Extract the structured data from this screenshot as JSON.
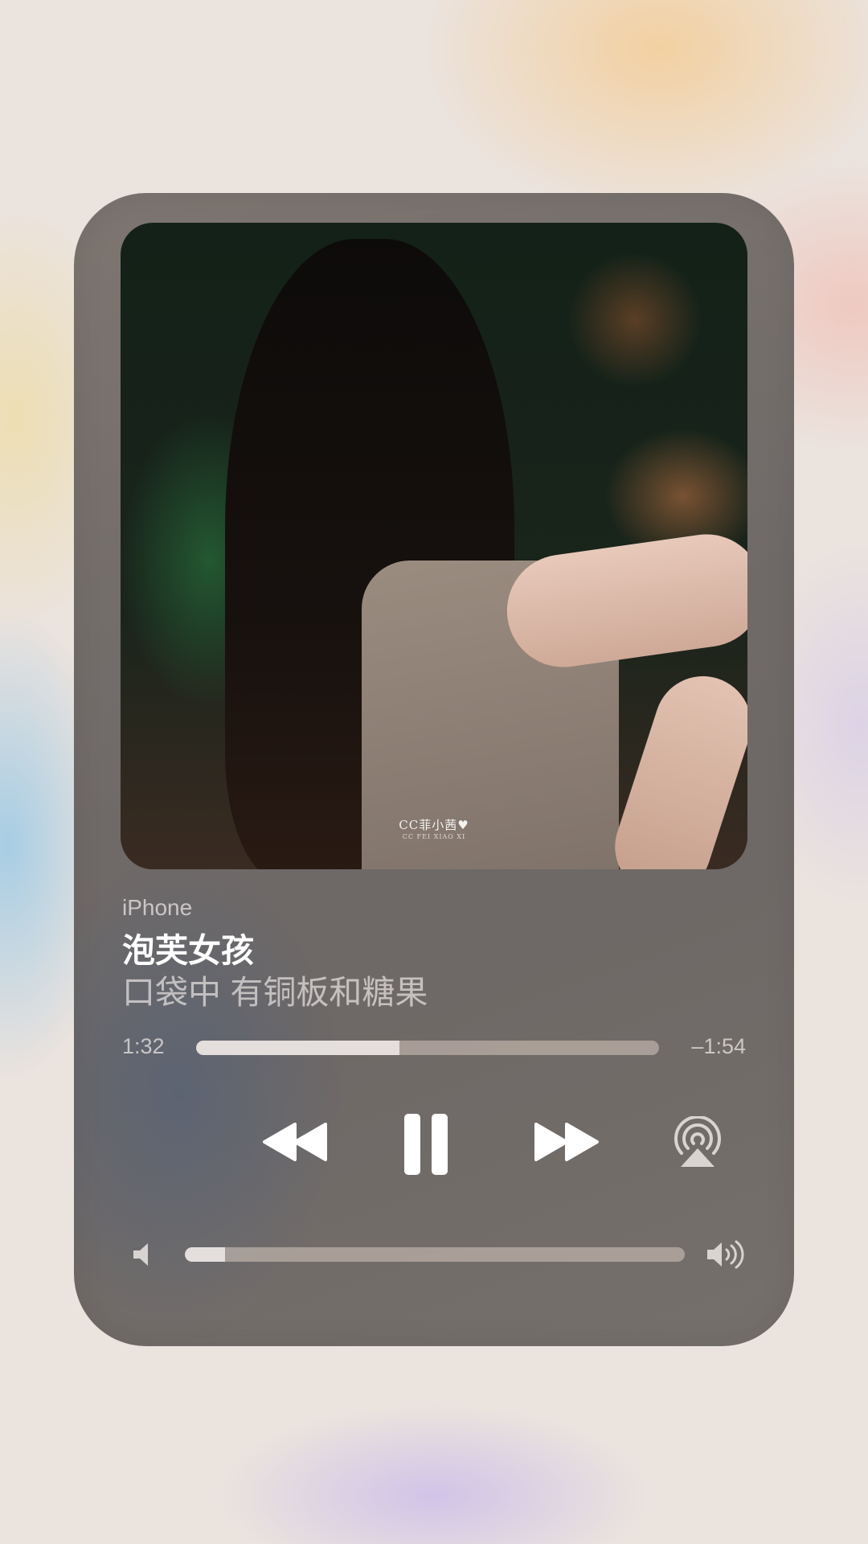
{
  "player": {
    "source_device": "iPhone",
    "song_title": "泡芙女孩",
    "subtitle": "口袋中 有铜板和糖果",
    "artwork_watermark": {
      "main": "CC菲小茜♥",
      "sub": "CC FEI XIAO XI"
    },
    "elapsed": "1:32",
    "remaining": "–1:54",
    "progress": 0.44,
    "volume": 0.08
  },
  "icons": {
    "rewind": "rewind-icon",
    "pause": "pause-icon",
    "forward": "fast-forward-icon",
    "airplay": "airplay-icon",
    "volume_low": "speaker-low-icon",
    "volume_high": "speaker-high-icon"
  },
  "colors": {
    "panel": "#736d6a",
    "text_primary": "#ffffff",
    "text_secondary": "#e6e1df"
  }
}
